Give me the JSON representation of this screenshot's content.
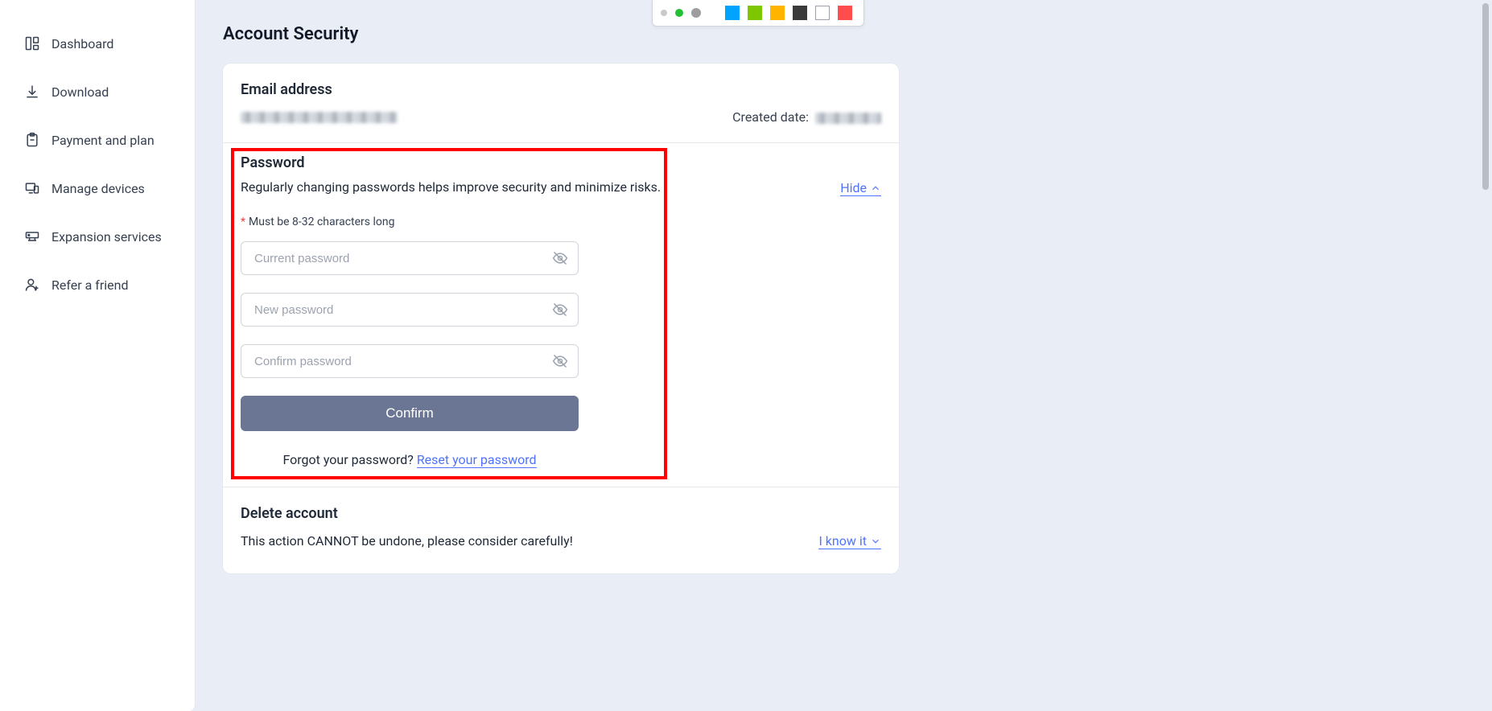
{
  "sidebar": {
    "items": [
      {
        "label": "Dashboard"
      },
      {
        "label": "Download"
      },
      {
        "label": "Payment and plan"
      },
      {
        "label": "Manage devices"
      },
      {
        "label": "Expansion services"
      },
      {
        "label": "Refer a friend"
      }
    ]
  },
  "page": {
    "title": "Account Security"
  },
  "email_section": {
    "heading": "Email address",
    "created_label": "Created date:",
    "email_value": "[redacted]",
    "created_value": "[redacted]"
  },
  "password_section": {
    "heading": "Password",
    "desc": "Regularly changing passwords helps improve security and minimize risks.",
    "hide_label": "Hide",
    "hint": "Must be 8-32 characters long",
    "placeholders": {
      "current": "Current password",
      "new_pw": "New password",
      "confirm": "Confirm password"
    },
    "confirm_button": "Confirm",
    "forgot_prefix": "Forgot your password? ",
    "reset_link": "Reset your password"
  },
  "delete_section": {
    "heading": "Delete account",
    "desc": "This action CANNOT be undone, please consider carefully!",
    "iknow_label": "I know it"
  },
  "palette": {
    "colors": [
      "#00a3ff",
      "#7cc700",
      "#ffb400",
      "#3a3a3a",
      "#ffffff",
      "#ff4d4d"
    ]
  }
}
